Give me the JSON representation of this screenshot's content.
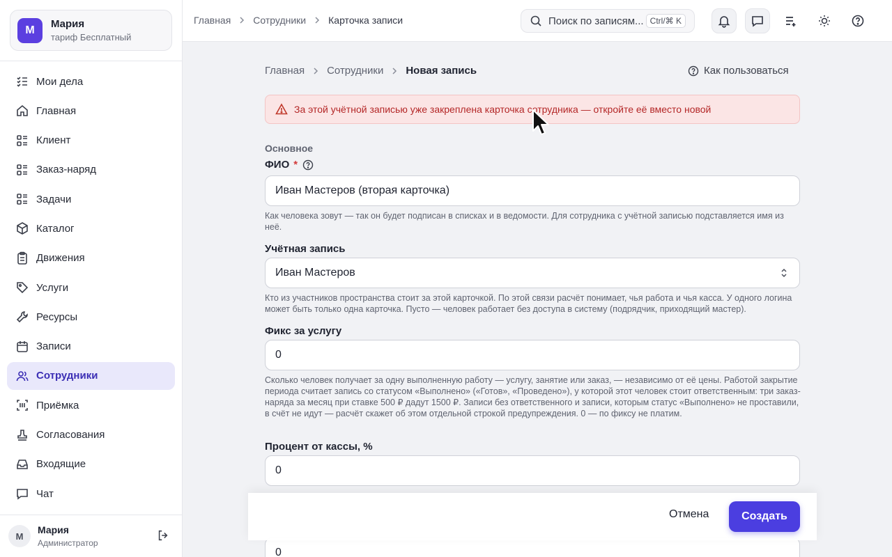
{
  "workspace": {
    "avatar_letter": "М",
    "name": "Мария",
    "plan": "тариф Бесплатный"
  },
  "nav": [
    {
      "label": "Мои дела",
      "icon": "list-check-icon",
      "active": false
    },
    {
      "label": "Главная",
      "icon": "home-icon",
      "active": false
    },
    {
      "label": "Клиент",
      "icon": "list-grid-icon",
      "active": false
    },
    {
      "label": "Заказ-наряд",
      "icon": "list-grid-icon",
      "active": false
    },
    {
      "label": "Задачи",
      "icon": "list-grid-icon",
      "active": false
    },
    {
      "label": "Каталог",
      "icon": "box-icon",
      "active": false
    },
    {
      "label": "Движения",
      "icon": "clipboard-icon",
      "active": false
    },
    {
      "label": "Услуги",
      "icon": "tag-icon",
      "active": false
    },
    {
      "label": "Ресурсы",
      "icon": "wrench-icon",
      "active": false
    },
    {
      "label": "Записи",
      "icon": "calendar-icon",
      "active": false
    },
    {
      "label": "Сотрудники",
      "icon": "users-icon",
      "active": true
    },
    {
      "label": "Приёмка",
      "icon": "scan-icon",
      "active": false
    },
    {
      "label": "Согласования",
      "icon": "stamp-icon",
      "active": false
    },
    {
      "label": "Входящие",
      "icon": "inbox-icon",
      "active": false
    },
    {
      "label": "Чат",
      "icon": "chat-icon",
      "active": false
    }
  ],
  "user": {
    "avatar_letter": "М",
    "name": "Мария",
    "role": "Администратор"
  },
  "topbar": {
    "breadcrumbs": [
      "Главная",
      "Сотрудники",
      "Карточка записи"
    ],
    "search_placeholder": "Поиск по записям...",
    "search_shortcut": "Ctrl/⌘ K"
  },
  "content": {
    "breadcrumbs": [
      "Главная",
      "Сотрудники",
      "Новая запись"
    ],
    "help_link": "Как пользоваться",
    "alert": "За этой учётной записью уже закреплена карточка сотрудника — откройте её вместо новой",
    "section_title": "Основное",
    "fio": {
      "label": "ФИО",
      "required_mark": "*",
      "value": "Иван Мастеров (вторая карточка)",
      "hint": "Как человека зовут — так он будет подписан в списках и в ведомости. Для сотрудника с учётной записью подставляется имя из неё."
    },
    "account": {
      "label": "Учётная запись",
      "value": "Иван Мастеров",
      "hint": "Кто из участников пространства стоит за этой карточкой. По этой связи расчёт понимает, чья работа и чья касса. У одного логина может быть только одна карточка. Пусто — человек работает без доступа в систему (подрядчик, приходящий мастер)."
    },
    "fix": {
      "label": "Фикс за услугу",
      "value": "0",
      "hint": "Сколько человек получает за одну выполненную работу — услугу, занятие или заказ, — независимо от её цены. Работой закрытие периода считает запись со статусом «Выполнено» («Готов», «Проведено»), у которой этот человек стоит ответственным: три заказ-наряда за месяц при ставке 500 ₽ дадут 1500 ₽. Записи без ответственного и записи, которым статус «Выполнено» не проставили, в счёт не идут — расчёт скажет об этом отдельной строкой предупреждения. 0 — по фиксу не платим."
    },
    "percent": {
      "label": "Процент от кассы, %",
      "value": "0"
    },
    "next_field_value": "0"
  },
  "actions": {
    "cancel": "Отмена",
    "create": "Создать"
  },
  "colors": {
    "accent": "#4b3ee0",
    "active_nav_bg": "#e9e8fb",
    "alert_bg": "#fbe5e5",
    "alert_text": "#b42727"
  }
}
